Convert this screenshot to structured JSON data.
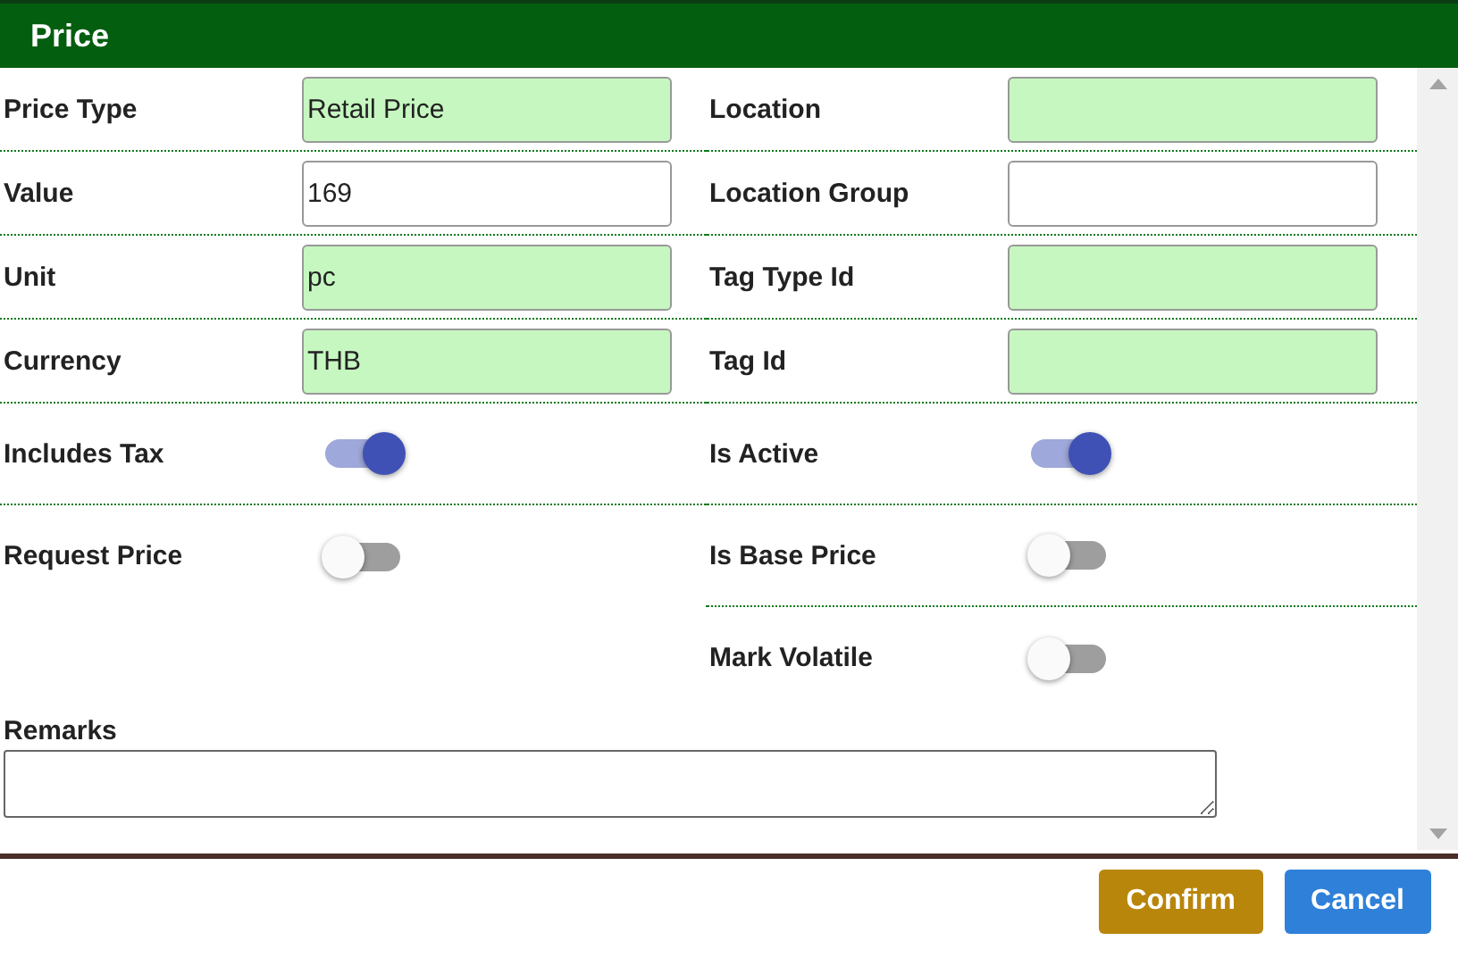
{
  "dialog": {
    "title": "Price"
  },
  "rows": [
    {
      "left": {
        "kind": "field",
        "label": "Price Type",
        "value": "Retail Price",
        "highlighted": true
      },
      "right": {
        "kind": "field",
        "label": "Location",
        "highlighted": true
      }
    },
    {
      "left": {
        "kind": "field",
        "label": "Value",
        "value": "169",
        "highlighted": false
      },
      "right": {
        "kind": "field",
        "label": "Location Group",
        "highlighted": false
      }
    },
    {
      "left": {
        "kind": "field",
        "label": "Unit",
        "value": "pc",
        "highlighted": true
      },
      "right": {
        "kind": "field",
        "label": "Tag Type Id",
        "highlighted": true
      }
    },
    {
      "left": {
        "kind": "field",
        "label": "Currency",
        "value": "THB",
        "highlighted": true
      },
      "right": {
        "kind": "field",
        "label": "Tag Id",
        "highlighted": true
      }
    },
    {
      "left": {
        "kind": "toggle",
        "label": "Includes Tax",
        "on": true
      },
      "right": {
        "kind": "toggle",
        "label": "Is Active",
        "on": true
      }
    },
    {
      "left": {
        "kind": "toggle",
        "label": "Request Price",
        "on": false
      },
      "right": {
        "kind": "toggle",
        "label": "Is Base Price",
        "on": false
      }
    },
    {
      "right": {
        "kind": "toggle",
        "label": "Mark Volatile",
        "on": false
      }
    }
  ],
  "remarks": {
    "label": "Remarks"
  },
  "buttons": [
    {
      "label": "Confirm",
      "kind": "primary"
    },
    {
      "label": "Cancel",
      "kind": "secondary"
    }
  ]
}
